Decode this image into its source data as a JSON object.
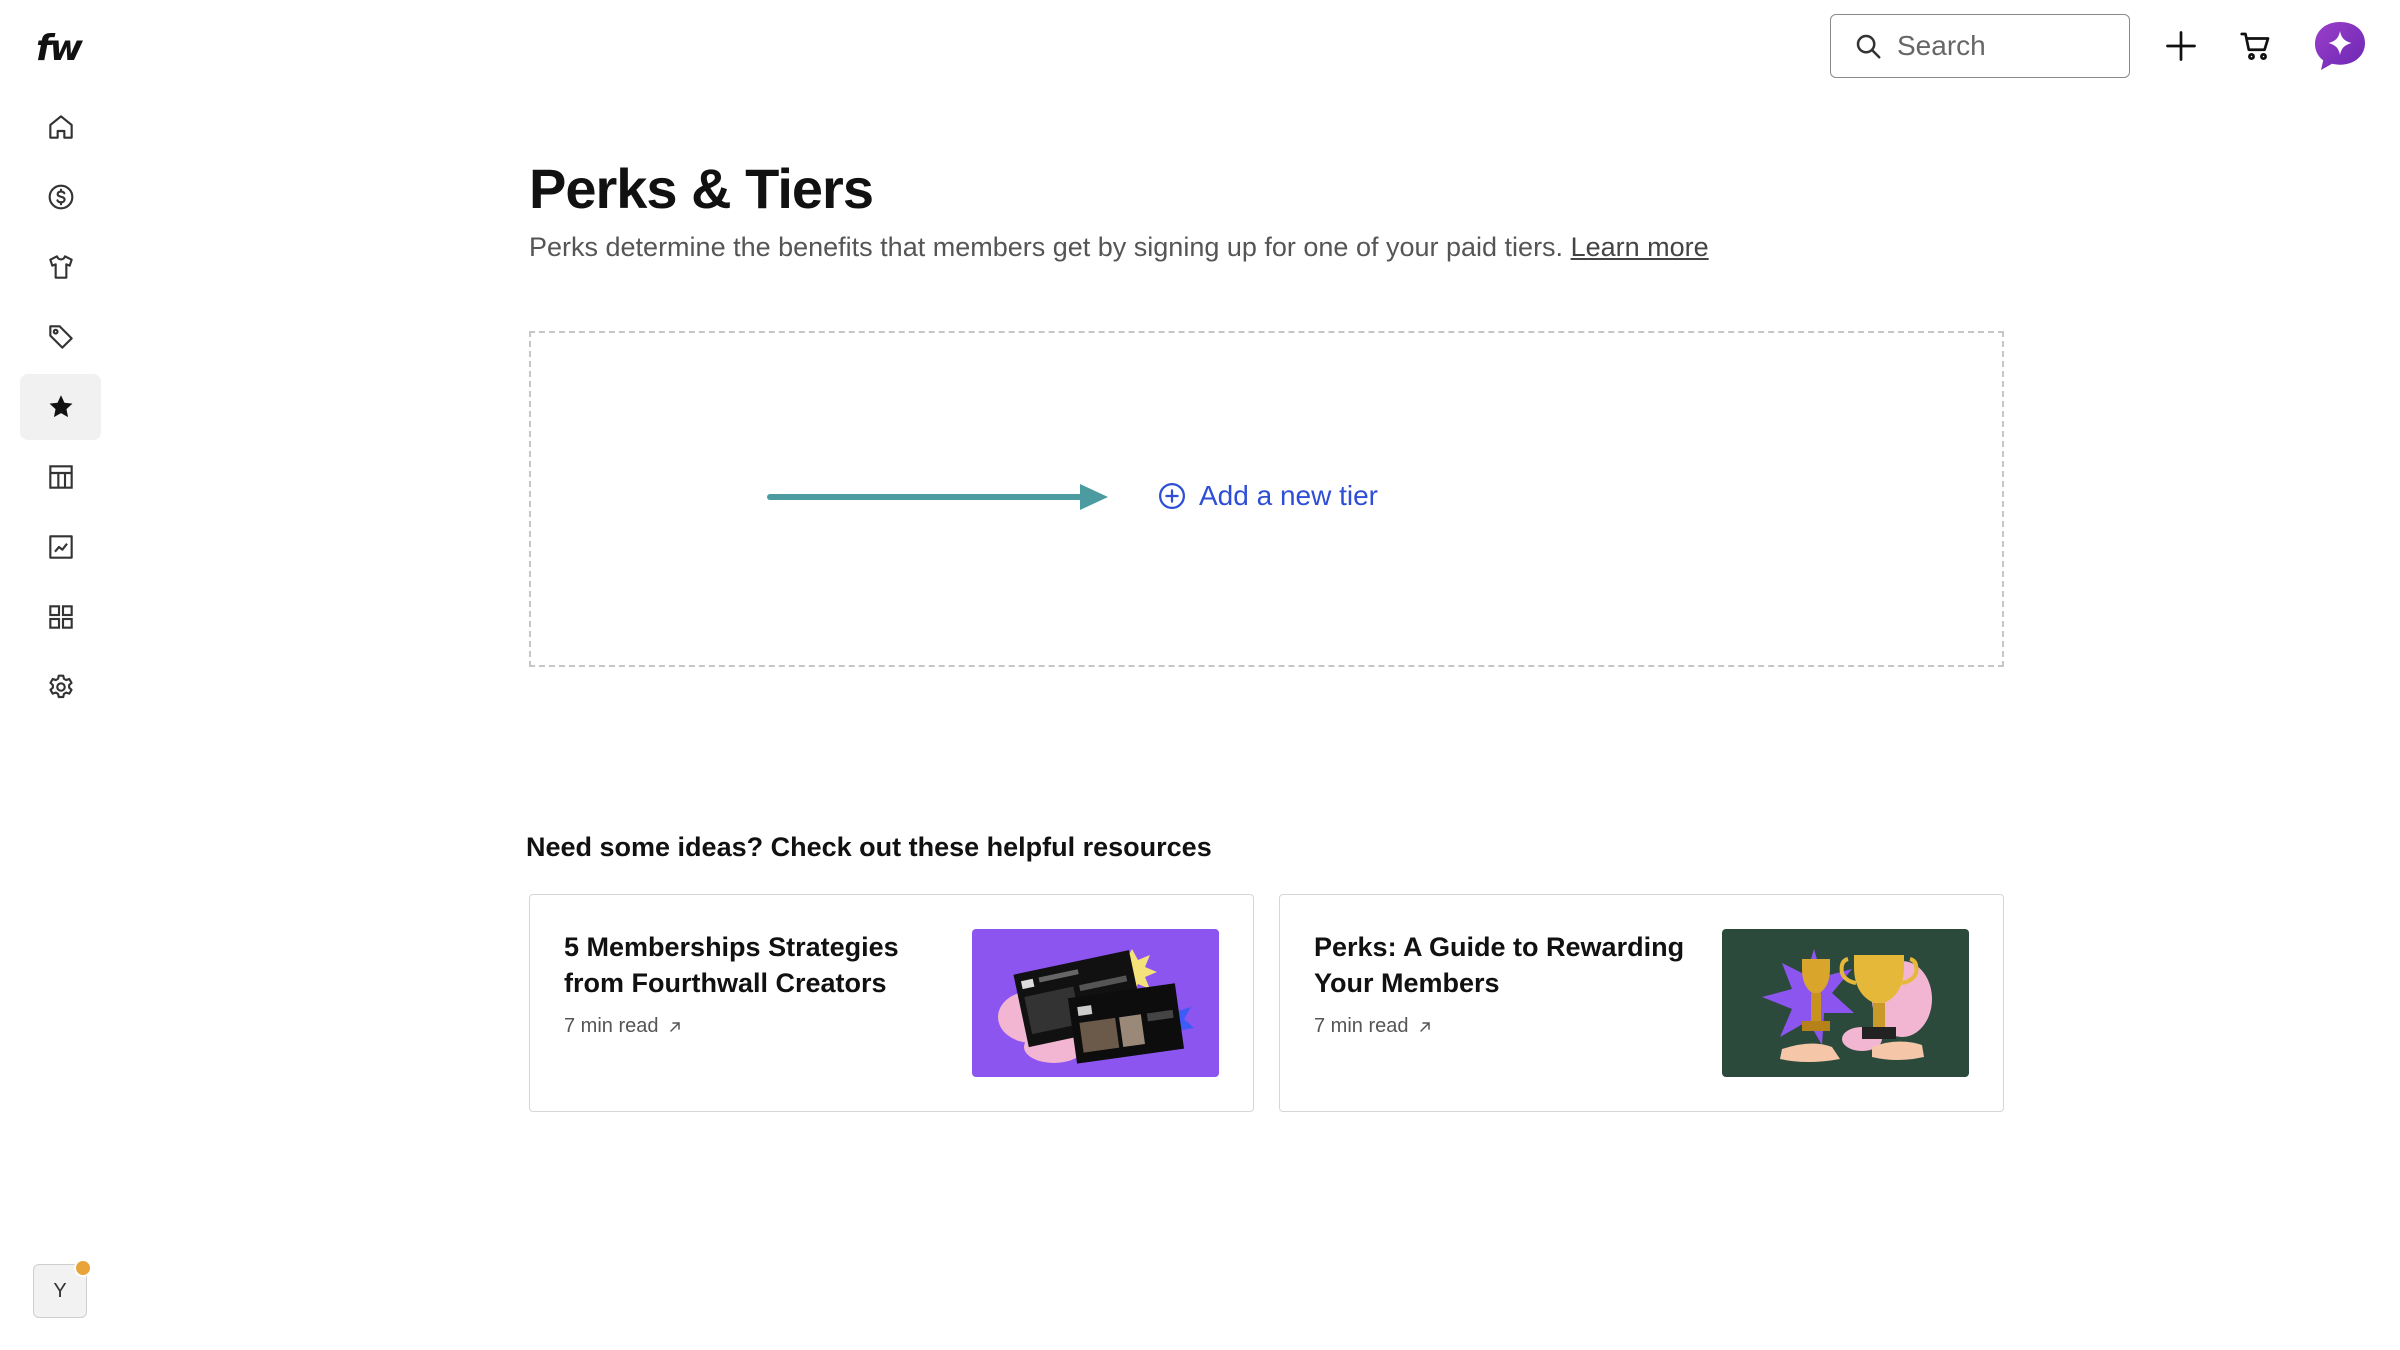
{
  "brand": {
    "logo_text": "fw"
  },
  "sidebar": {
    "items": [
      {
        "name": "home",
        "icon": "home-icon"
      },
      {
        "name": "payouts",
        "icon": "dollar-circle-icon"
      },
      {
        "name": "products",
        "icon": "tshirt-icon"
      },
      {
        "name": "promotions",
        "icon": "tag-icon"
      },
      {
        "name": "perks",
        "icon": "star-icon",
        "active": true
      },
      {
        "name": "layout",
        "icon": "layout-icon"
      },
      {
        "name": "analytics",
        "icon": "analytics-icon"
      },
      {
        "name": "apps",
        "icon": "apps-grid-icon"
      },
      {
        "name": "settings",
        "icon": "gear-icon"
      }
    ],
    "user_initial": "Y",
    "notification_color": "#e8a33a"
  },
  "topbar": {
    "search_placeholder": "Search",
    "icons": [
      "search-icon",
      "plus-icon",
      "cart-icon",
      "sparkle-chat-icon"
    ],
    "assistant_color": "#7a2fbf"
  },
  "main": {
    "title": "Perks & Tiers",
    "description": "Perks determine the benefits that members get by signing up for one of your paid tiers.",
    "learn_more": "Learn more",
    "add_tier_label": "Add a new tier",
    "accent_color": "#2e4ed6",
    "arrow_color": "#4b9ba0"
  },
  "resources": {
    "heading": "Need some ideas? Check out these helpful resources",
    "cards": [
      {
        "title": "5 Memberships Strategies from Fourthwall Creators",
        "meta": "7 min read",
        "thumb_color": "#8c55f0"
      },
      {
        "title": "Perks: A Guide to Rewarding Your Members",
        "meta": "7 min read",
        "thumb_color": "#2b4a3c"
      }
    ]
  }
}
